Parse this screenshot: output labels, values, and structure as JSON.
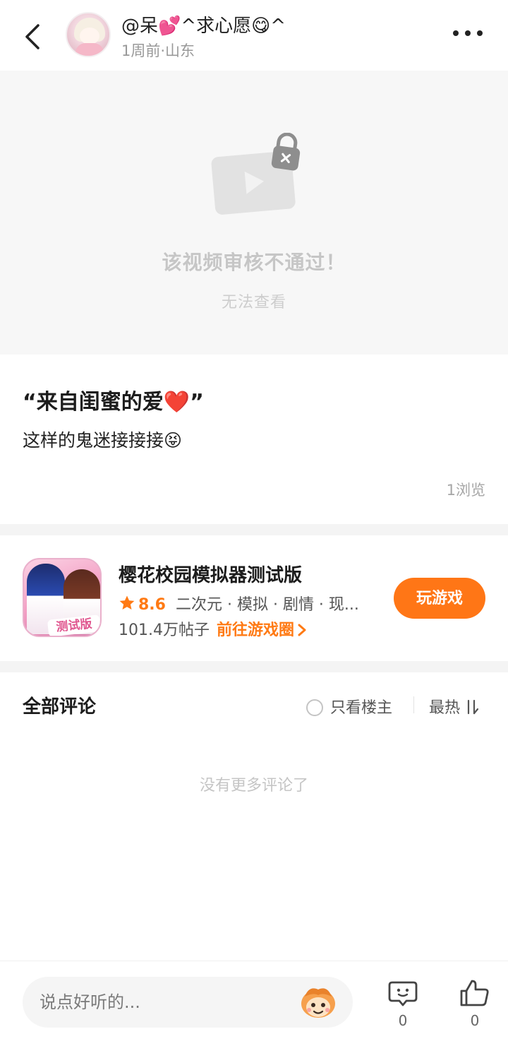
{
  "header": {
    "username": "@呆💕^求心愿😋^",
    "time_location": "1周前·山东"
  },
  "video": {
    "title": "该视频审核不通过！",
    "subtitle": "无法查看"
  },
  "post": {
    "title": "“来自闺蜜的爱❤️”",
    "body": "这样的鬼迷接接接😝",
    "views": "1浏览"
  },
  "game": {
    "icon_tag": "测试版",
    "name": "樱花校园模拟器测试版",
    "rating": "8.6",
    "tags": "二次元 · 模拟 · 剧情 · 现...",
    "posts": "101.4万帖子",
    "circle_link": "前往游戏圈",
    "play_label": "玩游戏"
  },
  "comments": {
    "title": "全部评论",
    "op_only_label": "只看楼主",
    "sort_label": "最热",
    "empty_text": "没有更多评论了"
  },
  "bottom_bar": {
    "input_placeholder": "说点好听的...",
    "comment_count": "0",
    "like_count": "0"
  },
  "colors": {
    "accent": "#ff7616",
    "rating": "#ff7a14"
  },
  "icons": [
    "back-icon",
    "more-icon",
    "locked-video-icon",
    "star-icon",
    "chevron-right-icon",
    "sort-icon",
    "emoji-icon",
    "comment-icon",
    "thumbs-up-icon"
  ]
}
